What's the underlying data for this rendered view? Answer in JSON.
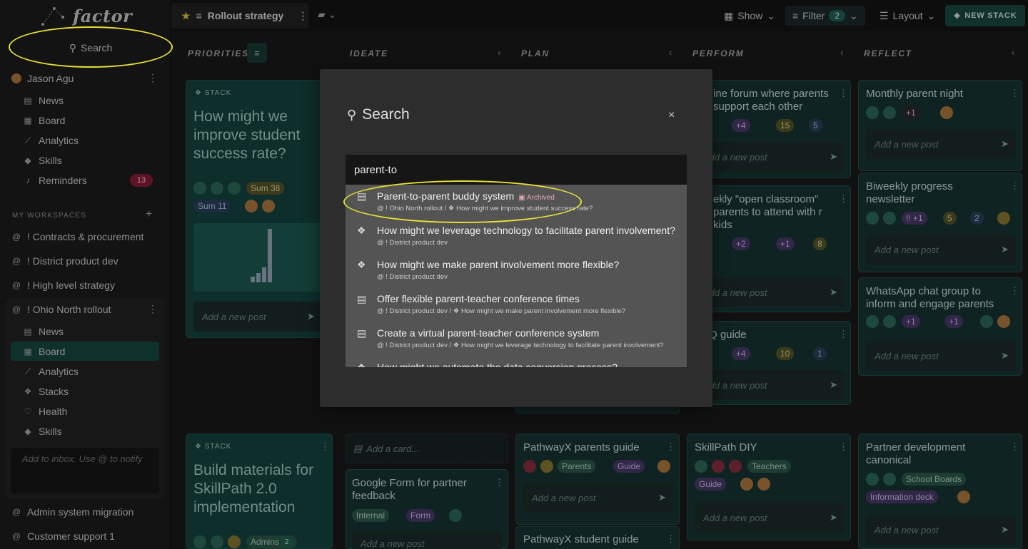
{
  "app": {
    "logo": "factor"
  },
  "sidebar": {
    "search_label": "Search",
    "user": "Jason Agu",
    "nav": [
      {
        "label": "News",
        "icon": "news-icon"
      },
      {
        "label": "Board",
        "icon": "board-icon"
      },
      {
        "label": "Analytics",
        "icon": "analytics-icon"
      },
      {
        "label": "Skills",
        "icon": "skills-icon"
      },
      {
        "label": "Reminders",
        "icon": "bell-icon",
        "badge": "13"
      }
    ],
    "workspaces_header": "MY WORKSPACES",
    "workspaces": [
      "! Contracts & procurement",
      "! District product dev",
      "! High level strategy",
      "! Ohio North rollout"
    ],
    "ohio_nav": [
      "News",
      "Board",
      "Analytics",
      "Stacks",
      "Health",
      "Skills"
    ],
    "inbox_placeholder": "Add to inbox. Use @ to notify",
    "more_workspaces": [
      "Admin system migration",
      "Customer support 1"
    ]
  },
  "topbar": {
    "tab_title": "Rollout strategy",
    "show_label": "Show",
    "filter_label": "Filter",
    "filter_count": "2",
    "layout_label": "Layout",
    "new_stack_label": "NEW STACK"
  },
  "columns": [
    "PRIORITIES",
    "IDEATE",
    "PLAN",
    "PERFORM",
    "REFLECT"
  ],
  "cards": {
    "stack_tag": "STACK",
    "stack1_title": "How might we improve student success rate?",
    "stack1_chips": [
      "Sum 38",
      "Sum 11"
    ],
    "stack2_title": "Build materials for SkillPath 2.0 implementation",
    "stack2_chip": "Admins",
    "stack2_chip_count": "2",
    "add_post": "Add a new post",
    "add_card": "Add a card...",
    "perform1_title": "ine forum where parents support each other",
    "perform1_chips": [
      "+4",
      "15",
      "5"
    ],
    "perform2_title": "ekly \"open classroom\" parents to attend with r kids",
    "perform2_chips": [
      "+2",
      "+1",
      "8"
    ],
    "perform3_title": "Q guide",
    "perform3_chips": [
      "+4",
      "10",
      "1"
    ],
    "reflect1_title": "Monthly parent night",
    "reflect1_chip": "+1",
    "reflect2_title": "Biweekly progress newsletter",
    "reflect2_chips": [
      "!! +1",
      "5",
      "2"
    ],
    "reflect3_title": "WhatsApp chat group to inform and engage parents",
    "reflect3_chips": [
      "+1",
      "+1"
    ],
    "ideate_title": "Google Form for partner feedback",
    "ideate_chips": [
      "Internal",
      "Form"
    ],
    "plan1_title": "PathwayX parents guide",
    "plan1_chips": [
      "Parents",
      "Guide"
    ],
    "plan2_title": "PathwayX student guide",
    "perform4_title": "SkillPath DIY",
    "perform4_chips": [
      "Teachers",
      "Guide"
    ],
    "reflect4_title": "Partner development canonical",
    "reflect4_chips": [
      "School Boards",
      "Information deck"
    ]
  },
  "modal": {
    "title": "Search",
    "query": "parent-to",
    "results": [
      {
        "title": "Parent-to-parent buddy system",
        "archived": "Archived",
        "path": "@ ! Ohio North rollout / ❖ How might we improve student success rate?",
        "icon": "post-icon"
      },
      {
        "title": "How might we leverage technology to facilitate parent involvement?",
        "path": "@ ! District product dev",
        "icon": "stack-icon"
      },
      {
        "title": "How might we make parent involvement more flexible?",
        "path": "@ ! District product dev",
        "icon": "stack-icon"
      },
      {
        "title": "Offer flexible parent-teacher conference times",
        "path": "@ ! District product dev / ❖ How might we make parent involvement more flexible?",
        "icon": "post-icon"
      },
      {
        "title": "Create a virtual parent-teacher conference system",
        "path": "@ ! District product dev / ❖ How might we leverage technology to facilitate parent involvement?",
        "icon": "post-icon"
      },
      {
        "title": "How might we automate the data conversion process?",
        "path": "",
        "icon": "stack-icon"
      }
    ]
  },
  "colors": {
    "highlight": "#e6e036",
    "accent": "#1e6355"
  }
}
